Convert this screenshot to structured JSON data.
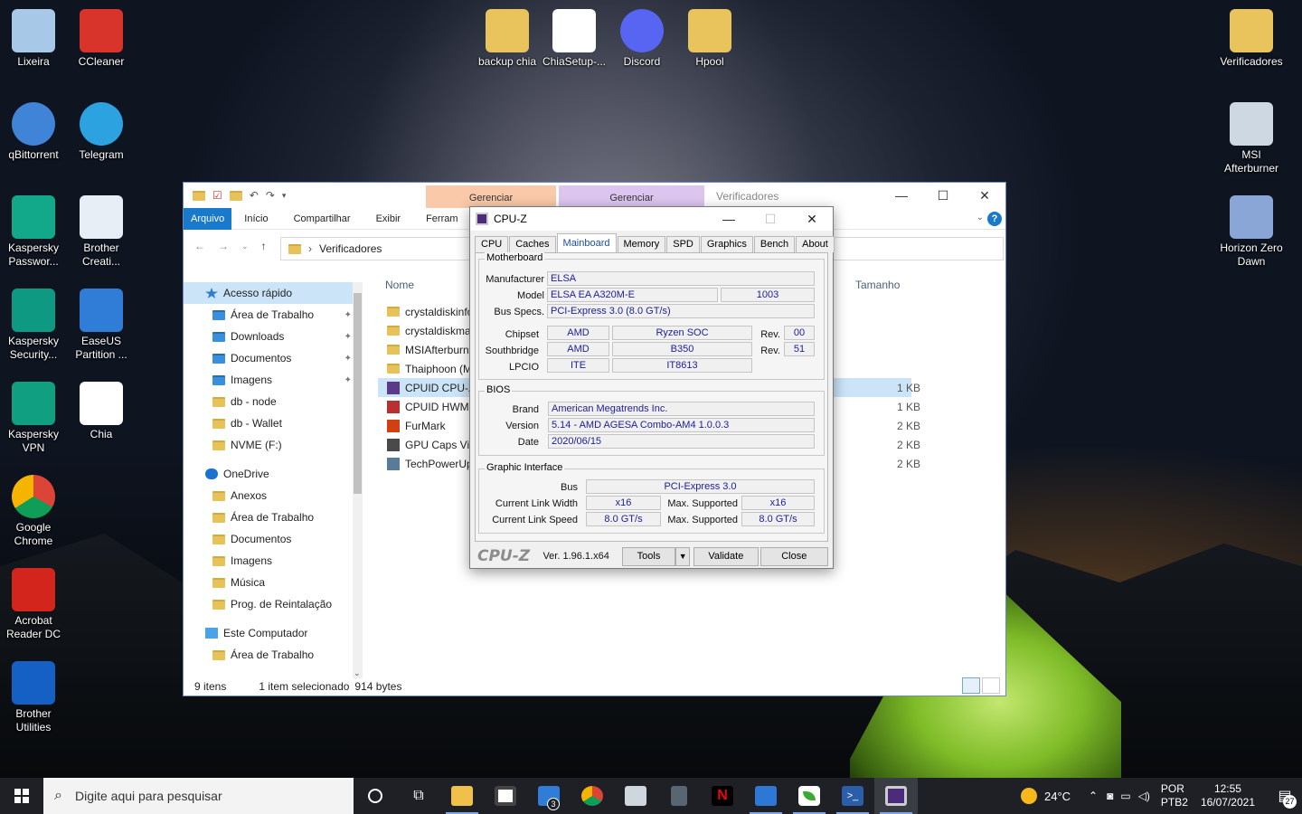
{
  "desktop": {
    "icons": [
      {
        "id": "lixeira",
        "label": "Lixeira"
      },
      {
        "id": "ccleaner",
        "label": "CCleaner"
      },
      {
        "id": "qbittorrent",
        "label": "qBittorrent"
      },
      {
        "id": "telegram",
        "label": "Telegram"
      },
      {
        "id": "kaspersky-pass",
        "label": "Kaspersky Passwor..."
      },
      {
        "id": "brother-creati",
        "label": "Brother Creati..."
      },
      {
        "id": "kaspersky-sec",
        "label": "Kaspersky Security..."
      },
      {
        "id": "easeus",
        "label": "EaseUS Partition ..."
      },
      {
        "id": "kaspersky-vpn",
        "label": "Kaspersky VPN"
      },
      {
        "id": "chia",
        "label": "Chia"
      },
      {
        "id": "chrome",
        "label": "Google Chrome"
      },
      {
        "id": "acrobat",
        "label": "Acrobat Reader DC"
      },
      {
        "id": "brother-util",
        "label": "Brother Utilities"
      },
      {
        "id": "backup-chia",
        "label": "backup chia"
      },
      {
        "id": "chiasetup",
        "label": "ChiaSetup-..."
      },
      {
        "id": "discord",
        "label": "Discord"
      },
      {
        "id": "hpool",
        "label": "Hpool"
      },
      {
        "id": "verificadores",
        "label": "Verificadores"
      },
      {
        "id": "msi-afterburner",
        "label": "MSI Afterburner"
      },
      {
        "id": "horizon",
        "label": "Horizon Zero Dawn"
      }
    ]
  },
  "explorer": {
    "title": "Verificadores",
    "context_tabs": [
      "Gerenciar",
      "Gerenciar"
    ],
    "ribbon_tabs": [
      "Arquivo",
      "Início",
      "Compartilhar",
      "Exibir",
      "Ferram"
    ],
    "address": "Verificadores",
    "sidebar": [
      {
        "label": "Acesso rápido",
        "top": true,
        "selected": true,
        "pin": false
      },
      {
        "label": "Área de Trabalho",
        "pin": true
      },
      {
        "label": "Downloads",
        "pin": true
      },
      {
        "label": "Documentos",
        "pin": true
      },
      {
        "label": "Imagens",
        "pin": true
      },
      {
        "label": "db - node",
        "pin": false
      },
      {
        "label": "db - Wallet",
        "pin": false
      },
      {
        "label": "NVME (F:)",
        "pin": false
      },
      {
        "label": "OneDrive",
        "top": true,
        "pin": false
      },
      {
        "label": "Anexos",
        "pin": false
      },
      {
        "label": "Área de Trabalho",
        "pin": false
      },
      {
        "label": "Documentos",
        "pin": false
      },
      {
        "label": "Imagens",
        "pin": false
      },
      {
        "label": "Música",
        "pin": false
      },
      {
        "label": "Prog. de Reintalação",
        "pin": false
      },
      {
        "label": "Este Computador",
        "top": true,
        "pin": false
      },
      {
        "label": "Área de Trabalho",
        "pin": false
      }
    ],
    "columns": {
      "name": "Nome",
      "size": "Tamanho"
    },
    "files": [
      {
        "name": "crystaldiskinfo",
        "size": "",
        "type": "folder"
      },
      {
        "name": "crystaldiskma",
        "size": "",
        "type": "folder"
      },
      {
        "name": "MSIAfterburn",
        "size": "",
        "type": "folder"
      },
      {
        "name": "Thaiphoon (M",
        "size": "",
        "type": "folder"
      },
      {
        "name": "CPUID CPU-Z",
        "size": "1 KB",
        "type": "app",
        "selected": true
      },
      {
        "name": "CPUID HWMo",
        "size": "1 KB",
        "type": "app"
      },
      {
        "name": "FurMark",
        "size": "2 KB",
        "type": "app"
      },
      {
        "name": "GPU Caps Vie",
        "size": "2 KB",
        "type": "app"
      },
      {
        "name": "TechPowerUp",
        "size": "2 KB",
        "type": "app"
      }
    ],
    "status": {
      "count": "9 itens",
      "selected": "1 item selecionado",
      "bytes": "914 bytes"
    }
  },
  "cpuz": {
    "title": "CPU-Z",
    "tabs": [
      "CPU",
      "Caches",
      "Mainboard",
      "Memory",
      "SPD",
      "Graphics",
      "Bench",
      "About"
    ],
    "active_tab": "Mainboard",
    "motherboard": {
      "group": "Motherboard",
      "manufacturer_label": "Manufacturer",
      "manufacturer": "ELSA",
      "model_label": "Model",
      "model": "ELSA EA A320M-E",
      "model_rev": "1003",
      "bus_label": "Bus Specs.",
      "bus": "PCI-Express 3.0 (8.0 GT/s)",
      "chipset_label": "Chipset",
      "chipset_vendor": "AMD",
      "chipset": "Ryzen SOC",
      "chipset_rev_label": "Rev.",
      "chipset_rev": "00",
      "south_label": "Southbridge",
      "south_vendor": "AMD",
      "south": "B350",
      "south_rev_label": "Rev.",
      "south_rev": "51",
      "lpcio_label": "LPCIO",
      "lpcio_vendor": "ITE",
      "lpcio": "IT8613"
    },
    "bios": {
      "group": "BIOS",
      "brand_label": "Brand",
      "brand": "American Megatrends Inc.",
      "version_label": "Version",
      "version": "5.14 - AMD AGESA Combo-AM4 1.0.0.3",
      "date_label": "Date",
      "date": "2020/06/15"
    },
    "graphic": {
      "group": "Graphic Interface",
      "bus_label": "Bus",
      "bus": "PCI-Express 3.0",
      "width_label": "Current Link Width",
      "width": "x16",
      "max_label": "Max. Supported",
      "width_max": "x16",
      "speed_label": "Current Link Speed",
      "speed": "8.0 GT/s",
      "speed_max": "8.0 GT/s"
    },
    "footer": {
      "brand": "CPU-Z",
      "version": "Ver. 1.96.1.x64",
      "tools": "Tools",
      "validate": "Validate",
      "close": "Close"
    }
  },
  "taskbar": {
    "search_placeholder": "Digite aqui para pesquisar",
    "mail_badge": "3",
    "weather": "24°C",
    "lang_top": "POR",
    "lang_bottom": "PTB2",
    "time": "12:55",
    "date": "16/07/2021",
    "notif_count": "27"
  }
}
